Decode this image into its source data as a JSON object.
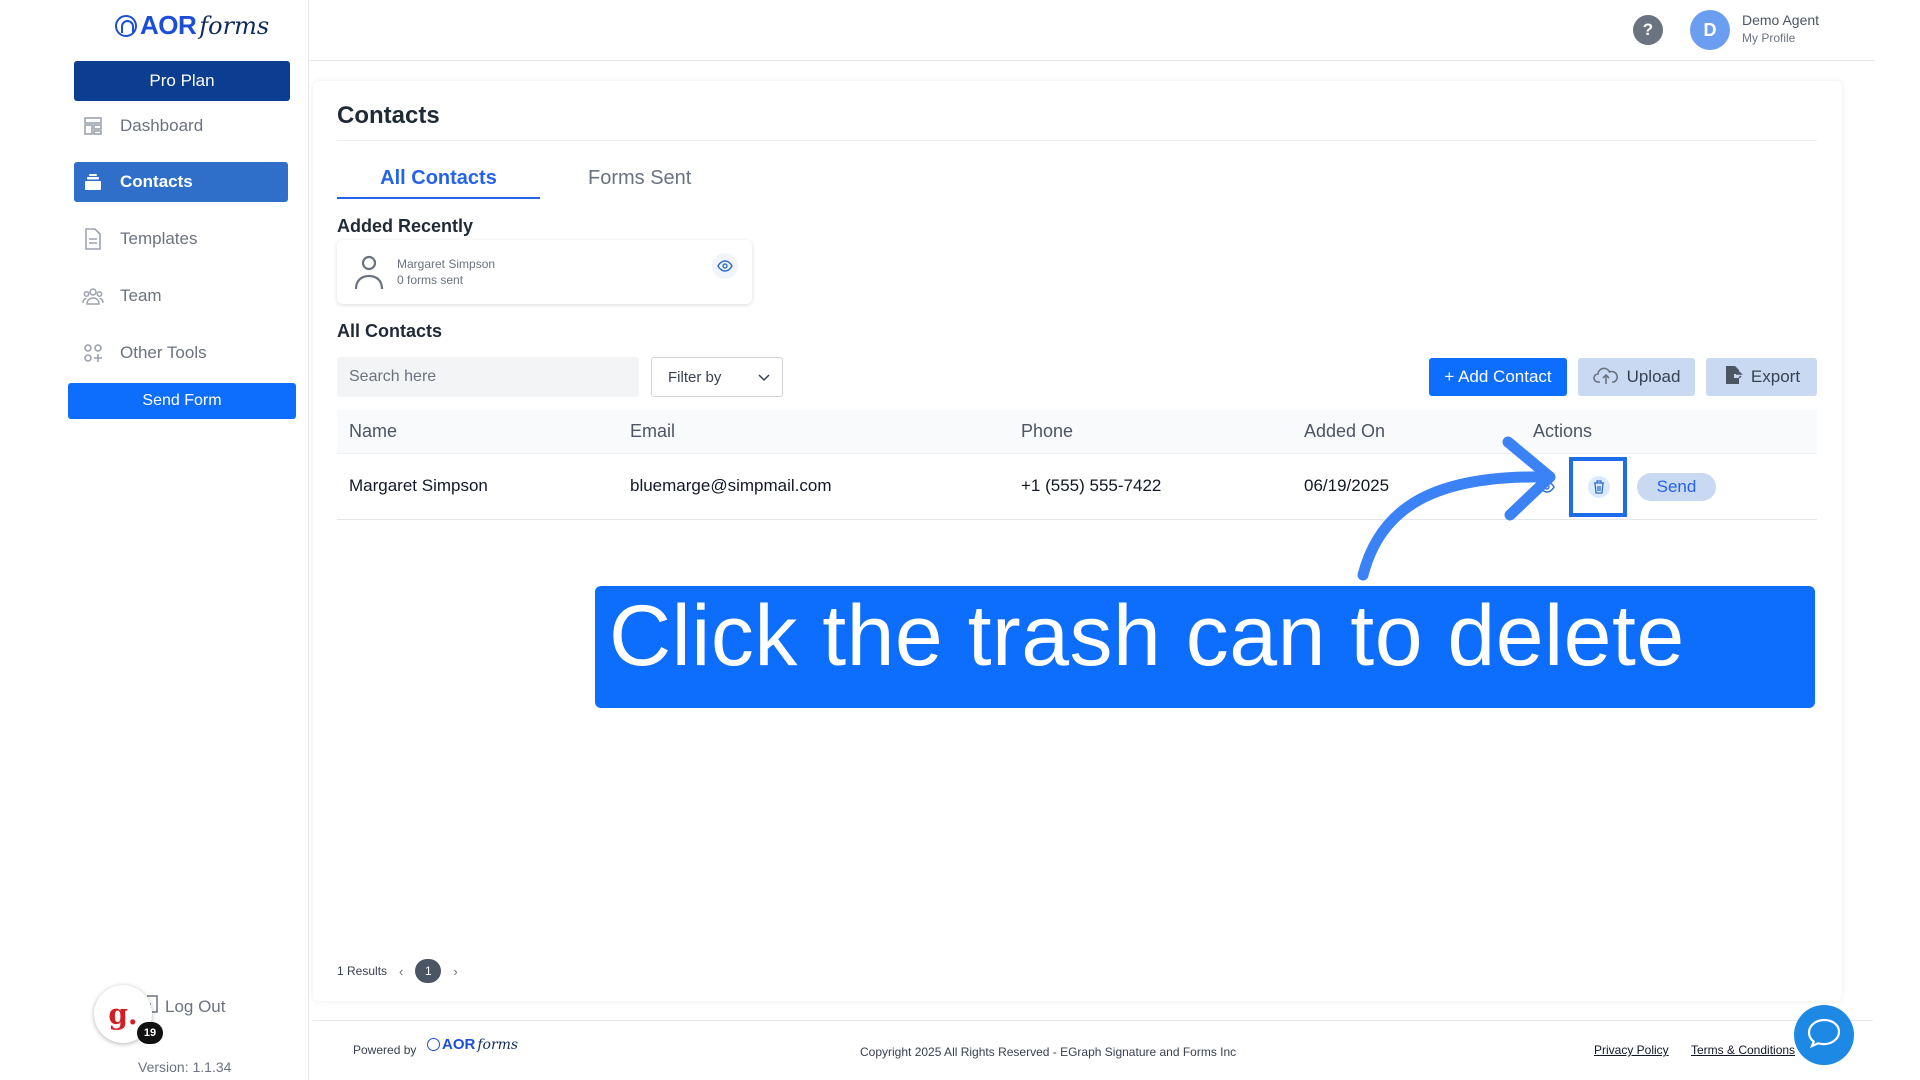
{
  "brand": {
    "logo_aor": "AOR",
    "logo_forms": "forms"
  },
  "sidebar": {
    "plan_label": "Pro Plan",
    "items": [
      {
        "label": "Dashboard",
        "icon": "dashboard-icon",
        "active": false
      },
      {
        "label": "Contacts",
        "icon": "contacts-icon",
        "active": true
      },
      {
        "label": "Templates",
        "icon": "document-icon",
        "active": false
      },
      {
        "label": "Team",
        "icon": "team-icon",
        "active": false
      },
      {
        "label": "Other Tools",
        "icon": "grid-plus-icon",
        "active": false
      }
    ],
    "send_form_label": "Send Form",
    "logout_label": "Log Out",
    "version": "Version: 1.1.34",
    "g2_count": "19",
    "g2_letter": "g."
  },
  "header": {
    "help_icon": "?",
    "avatar_initial": "D",
    "user_name": "Demo Agent",
    "user_sub": "My Profile"
  },
  "page": {
    "title": "Contacts",
    "tabs": [
      {
        "label": "All Contacts",
        "active": true
      },
      {
        "label": "Forms Sent",
        "active": false
      }
    ],
    "added_recently_label": "Added Recently",
    "recent": {
      "name": "Margaret Simpson",
      "sub": "0 forms sent"
    },
    "all_contacts_label": "All Contacts",
    "search_placeholder": "Search here",
    "filter_label": "Filter by",
    "buttons": {
      "add": "+ Add Contact",
      "upload": "Upload",
      "export": "Export"
    },
    "table": {
      "columns": [
        "Name",
        "Email",
        "Phone",
        "Added On",
        "Actions"
      ],
      "rows": [
        {
          "name": "Margaret Simpson",
          "email": "bluemarge@simpmail.com",
          "phone": "+1 (555) 555-7422",
          "added_on": "06/19/2025",
          "send_label": "Send"
        }
      ]
    },
    "pagination": {
      "results": "1 Results",
      "prev": "‹",
      "current": "1",
      "next": "›"
    }
  },
  "callout": {
    "text": "Click the trash can to delete"
  },
  "footer": {
    "powered_by": "Powered by",
    "copyright": "Copyright 2025 All Rights Reserved - EGraph Signature and Forms Inc",
    "privacy": "Privacy Policy",
    "terms": "Terms & Conditions"
  },
  "colors": {
    "primary": "#0d6efd",
    "navy": "#0b3d91",
    "active_nav": "#2f6fc9",
    "highlight": "#1d6de9"
  }
}
